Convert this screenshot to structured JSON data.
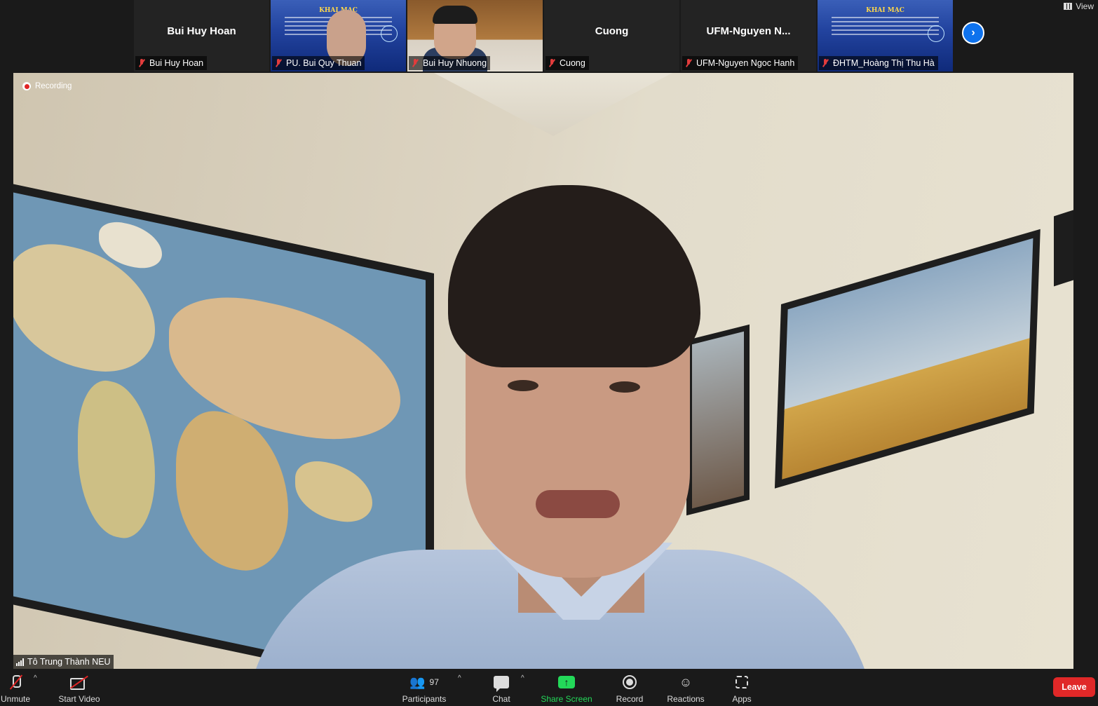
{
  "top_strip": {
    "tiles": [
      {
        "name": "Bui Huy Hoan",
        "center_name": "Bui Huy Hoan"
      },
      {
        "name": "PU. Bui Quy Thuan"
      },
      {
        "name": "Bui Huy Nhuong"
      },
      {
        "name": "Cuong",
        "center_name": "Cuong"
      },
      {
        "name": "UFM-Nguyen Ngoc Hanh",
        "center_name": "UFM-Nguyen  N..."
      },
      {
        "name": "ĐHTM_Hoàng Thị Thu Hà"
      }
    ],
    "poster_title": "KHAI MẠC",
    "next_icon": "chevron-right-icon",
    "view_label": "View"
  },
  "main_video": {
    "recording_label": "Recording",
    "speaker_name": "Tô Trung Thành NEU"
  },
  "toolbar": {
    "unmute": "Unmute",
    "start_video": "Start Video",
    "participants": "Participants",
    "participants_count": "97",
    "chat": "Chat",
    "share_screen": "Share Screen",
    "record": "Record",
    "reactions": "Reactions",
    "apps": "Apps",
    "leave": "Leave"
  },
  "colors": {
    "accent_blue": "#0e72ed",
    "share_green": "#23d959",
    "leave_red": "#e02828",
    "muted_red": "#e23c3c"
  }
}
